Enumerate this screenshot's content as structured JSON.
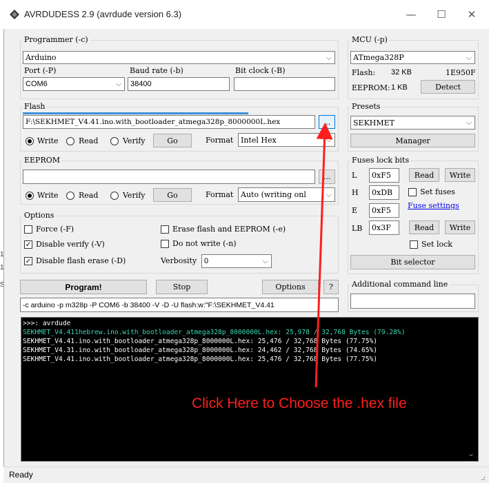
{
  "window": {
    "title": "AVRDUDESS 2.9 (avrdude version 6.3)",
    "controls": {
      "minimize": "—",
      "maximize": "☐",
      "close": "✕"
    }
  },
  "programmer": {
    "group_label": "Programmer (-c)",
    "selected": "Arduino",
    "port_label": "Port (-P)",
    "port_value": "COM6",
    "baud_label": "Baud rate (-b)",
    "baud_value": "38400",
    "bitclock_label": "Bit clock (-B)",
    "bitclock_value": ""
  },
  "mcu": {
    "group_label": "MCU (-p)",
    "selected": "ATmega328P",
    "flash_label": "Flash:",
    "flash_size": "32 KB",
    "signature": "1E950F",
    "eeprom_label": "EEPROM:",
    "eeprom_size": "1 KB",
    "detect_label": "Detect"
  },
  "flash": {
    "group_label": "Flash",
    "file_path": "F:\\SEKHMET_V4.41.ino.with_bootloader_atmega328p_8000000L.hex",
    "browse_label": "...",
    "write_label": "Write",
    "read_label": "Read",
    "verify_label": "Verify",
    "go_label": "Go",
    "format_label": "Format",
    "format_value": "Intel Hex",
    "selected_mode": "Write"
  },
  "presets": {
    "group_label": "Presets",
    "selected": "SEKHMET",
    "manager_label": "Manager"
  },
  "eeprom": {
    "group_label": "EEPROM",
    "file_path": "",
    "browse_label": "...",
    "write_label": "Write",
    "read_label": "Read",
    "verify_label": "Verify",
    "go_label": "Go",
    "format_label": "Format",
    "format_value": "Auto (writing onl"
  },
  "fuses": {
    "group_label": "Fuses  lock bits",
    "l_label": "L",
    "l_value": "0xF5",
    "h_label": "H",
    "h_value": "0xDB",
    "e_label": "E",
    "e_value": "0xF5",
    "lb_label": "LB",
    "lb_value": "0x3F",
    "read_label": "Read",
    "write_label": "Write",
    "set_fuses_label": "Set fuses",
    "fuse_settings_link": "Fuse settings",
    "set_lock_label": "Set lock",
    "bit_selector_label": "Bit selector"
  },
  "options": {
    "group_label": "Options",
    "force_label": "Force (-F)",
    "erase_label": "Erase flash and EEPROM (-e)",
    "disable_verify_label": "Disable verify (-V)",
    "do_not_write_label": "Do not write (-n)",
    "disable_flash_erase_label": "Disable flash erase (-D)",
    "verbosity_label": "Verbosity",
    "verbosity_value": "0",
    "check_mark": "✓"
  },
  "actions": {
    "program_label": "Program!",
    "stop_label": "Stop",
    "options_label": "Options",
    "help_label": "?"
  },
  "additional": {
    "group_label": "Additional command line",
    "args_value": ""
  },
  "command_line": "-c arduino -p m328p -P COM6 -b 38400 -V -D -U flash:w:\"F:\\SEKHMET_V4.41",
  "console": {
    "prompt": ">>>: avrdude",
    "lines": [
      "SEKHMET_V4.411hebrew.ino.with_bootloader_atmega328p_8000000L.hex: 25,978 / 32,768 Bytes (79.28%)",
      "SEKHMET_V4.41.ino.with_bootloader_atmega328p_8000000L.hex: 25,476 / 32,768 Bytes (77.75%)",
      "SEKHMET_V4.31.ino.with_bootloader_atmega328p_8000000L.hex: 24,462 / 32,768 Bytes (74.65%)",
      "SEKHMET_V4.41.ino.with_bootloader_atmega328p_8000000L.hex: 25,476 / 32,768 Bytes (77.75%)"
    ],
    "scroll_down": "⌄"
  },
  "status": "Ready",
  "annotation": "Click Here to Choose the .hex file",
  "left_edge_fragments": [
    "1c",
    "1c",
    "S-"
  ],
  "colors": {
    "annotation": "#ff1e1e",
    "console_bg": "#000000",
    "console_prompt": "#ffffff",
    "console_highlight": "#3ad6b0",
    "progress": "#3c8fdc",
    "link": "#0000ee"
  }
}
